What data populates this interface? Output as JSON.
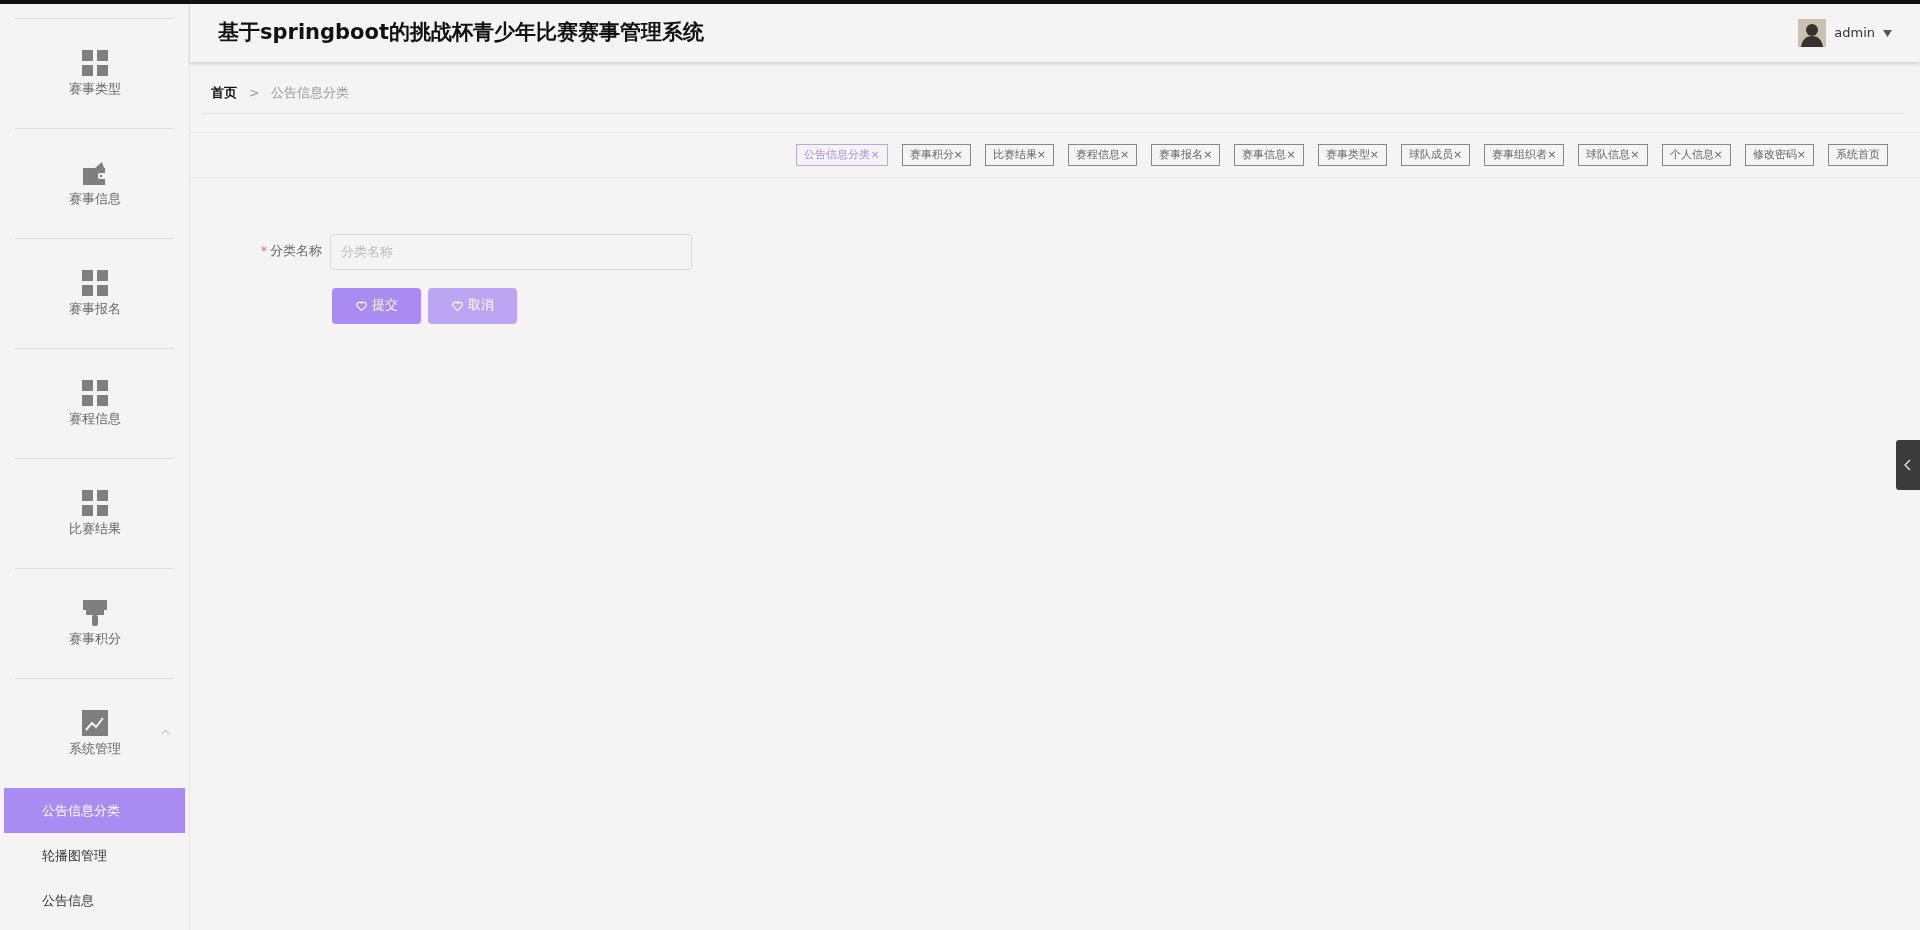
{
  "sidebar": {
    "items": [
      {
        "label": "赛事类型",
        "kind": "grid"
      },
      {
        "label": "赛事信息",
        "kind": "wallet"
      },
      {
        "label": "赛事报名",
        "kind": "grid"
      },
      {
        "label": "赛程信息",
        "kind": "grid"
      },
      {
        "label": "比赛结果",
        "kind": "grid"
      },
      {
        "label": "赛事积分",
        "kind": "brush"
      },
      {
        "label": "系统管理",
        "kind": "chart",
        "expanded": true,
        "children": [
          {
            "label": "公告信息分类",
            "selected": true
          },
          {
            "label": "轮播图管理",
            "selected": false
          },
          {
            "label": "公告信息",
            "selected": false
          }
        ]
      }
    ]
  },
  "header": {
    "title": "基于springboot的挑战杯青少年比赛赛事管理系统",
    "user": "admin"
  },
  "breadcrumb": [
    {
      "label": "首页",
      "current": false
    },
    {
      "label": "公告信息分类",
      "current": true
    }
  ],
  "breadcrumb_separator": ">",
  "tabs": [
    {
      "label": "公告信息分类",
      "close": "×",
      "selected": true
    },
    {
      "label": "赛事积分",
      "close": "×",
      "selected": false
    },
    {
      "label": "比赛结果",
      "close": "×",
      "selected": false
    },
    {
      "label": "赛程信息",
      "close": "×",
      "selected": false
    },
    {
      "label": "赛事报名",
      "close": "×",
      "selected": false
    },
    {
      "label": "赛事信息",
      "close": "×",
      "selected": false
    },
    {
      "label": "赛事类型",
      "close": "×",
      "selected": false
    },
    {
      "label": "球队成员",
      "close": "×",
      "selected": false
    },
    {
      "label": "赛事组织者",
      "close": "×",
      "selected": false
    },
    {
      "label": "球队信息",
      "close": "×",
      "selected": false
    },
    {
      "label": "个人信息",
      "close": "×",
      "selected": false
    },
    {
      "label": "修改密码",
      "close": "×",
      "selected": false
    },
    {
      "label": "系统首页",
      "selected": false
    }
  ],
  "form": {
    "fields": [
      {
        "label": "分类名称",
        "required": true,
        "required_mark": "*",
        "placeholder": "分类名称"
      }
    ],
    "buttons": [
      {
        "label": "提交",
        "hovered": false
      },
      {
        "label": "取消",
        "hovered": true
      }
    ]
  }
}
